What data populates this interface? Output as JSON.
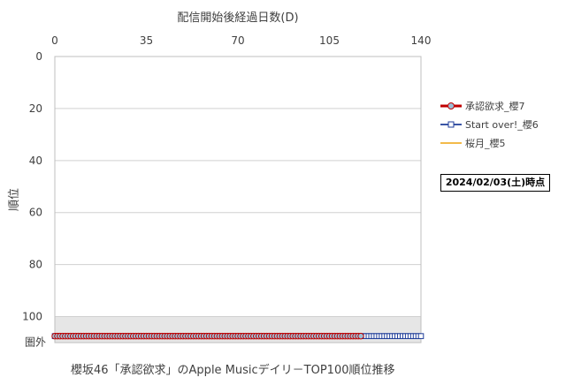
{
  "chart_data": {
    "type": "line",
    "xlabel": "配信開始後経過日数(D)",
    "ylabel": "順位",
    "caption": "櫻坂46「承認欲求」のApple Musicデイリ－TOP100順位推移",
    "date_note": "2024/02/03(土)時点",
    "xlim": [
      0,
      140
    ],
    "ylim": [
      0,
      110
    ],
    "y_reversed": true,
    "x_ticks": [
      "0",
      "35",
      "70",
      "105",
      "140"
    ],
    "y_ticks": [
      "0",
      "20",
      "40",
      "60",
      "80",
      "100"
    ],
    "y_outside_label": "圏外",
    "grid": "horizontal",
    "legend_position": "right",
    "series": [
      {
        "name": "承認欲求_櫻7",
        "color": "#c00000",
        "marker": "circle",
        "x_range": [
          0,
          117
        ],
        "value": "圏外"
      },
      {
        "name": "Start over!_櫻6",
        "color": "#1f3d99",
        "marker": "square",
        "x_range": [
          0,
          140
        ],
        "value": "圏外"
      },
      {
        "name": "桜月_櫻5",
        "color": "#f0b030",
        "marker": "none",
        "x_range": [],
        "value": "圏外"
      }
    ]
  }
}
